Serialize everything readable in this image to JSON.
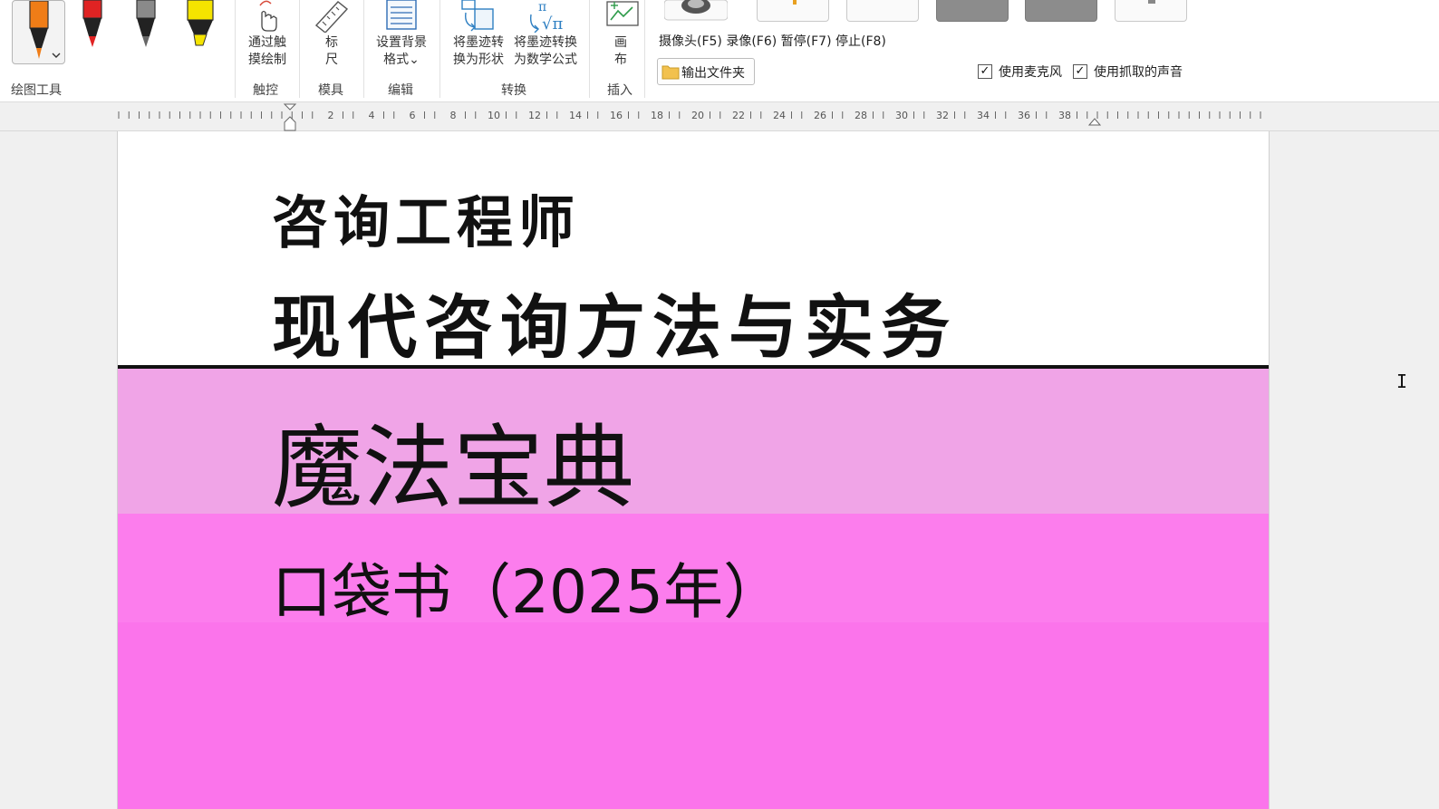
{
  "ribbon": {
    "drawing_tools": {
      "group_label": "绘图工具",
      "pens": [
        {
          "icon": "orange-pen-icon",
          "color": "#f07d17"
        },
        {
          "icon": "red-pen-icon",
          "color": "#e02323"
        },
        {
          "icon": "gray-pen-icon",
          "color": "#8a8a8a"
        },
        {
          "icon": "yellow-highlighter-icon",
          "color": "#f5e400"
        }
      ]
    },
    "touch": {
      "group_label": "触控",
      "button_label_line1": "通过触",
      "button_label_line2": "摸绘制"
    },
    "stencil": {
      "group_label": "模具",
      "button_label_line1": "标",
      "button_label_line2": "尺"
    },
    "edit": {
      "group_label": "编辑",
      "button_label_line1": "设置背景",
      "button_label_line2": "格式⌄"
    },
    "convert": {
      "group_label": "转换",
      "to_shape_line1": "将墨迹转",
      "to_shape_line2": "换为形状",
      "to_math_line1": "将墨迹转换",
      "to_math_line2": "为数学公式"
    },
    "insert": {
      "group_label": "插入",
      "button_label_line1": "画",
      "button_label_line2": "布"
    },
    "recorder": {
      "shortcut_text": "摄像头(F5) 录像(F6) 暂停(F7) 停止(F8)",
      "output_folder_label": "输出文件夹",
      "use_mic_label": "使用麦克风",
      "use_mic_checked": true,
      "use_capture_sound_label": "使用抓取的声音",
      "use_capture_sound_checked": true,
      "check_mark": "✓"
    }
  },
  "ruler": {
    "labels": [
      "2",
      "4",
      "6",
      "8",
      "10",
      "12",
      "14",
      "16",
      "18",
      "20",
      "22",
      "24",
      "26",
      "28",
      "30",
      "32",
      "34",
      "36",
      "38"
    ]
  },
  "document": {
    "title_line1": "咨询工程师",
    "title_line2": "现代咨询方法与实务",
    "band_title": "魔法宝典",
    "band_subtitle": "口袋书（2025年）",
    "colors": {
      "band1": "#f0a4e7",
      "band2": "#fc7ded",
      "band3": "#fb74eb"
    }
  },
  "cursor_glyph": "I"
}
